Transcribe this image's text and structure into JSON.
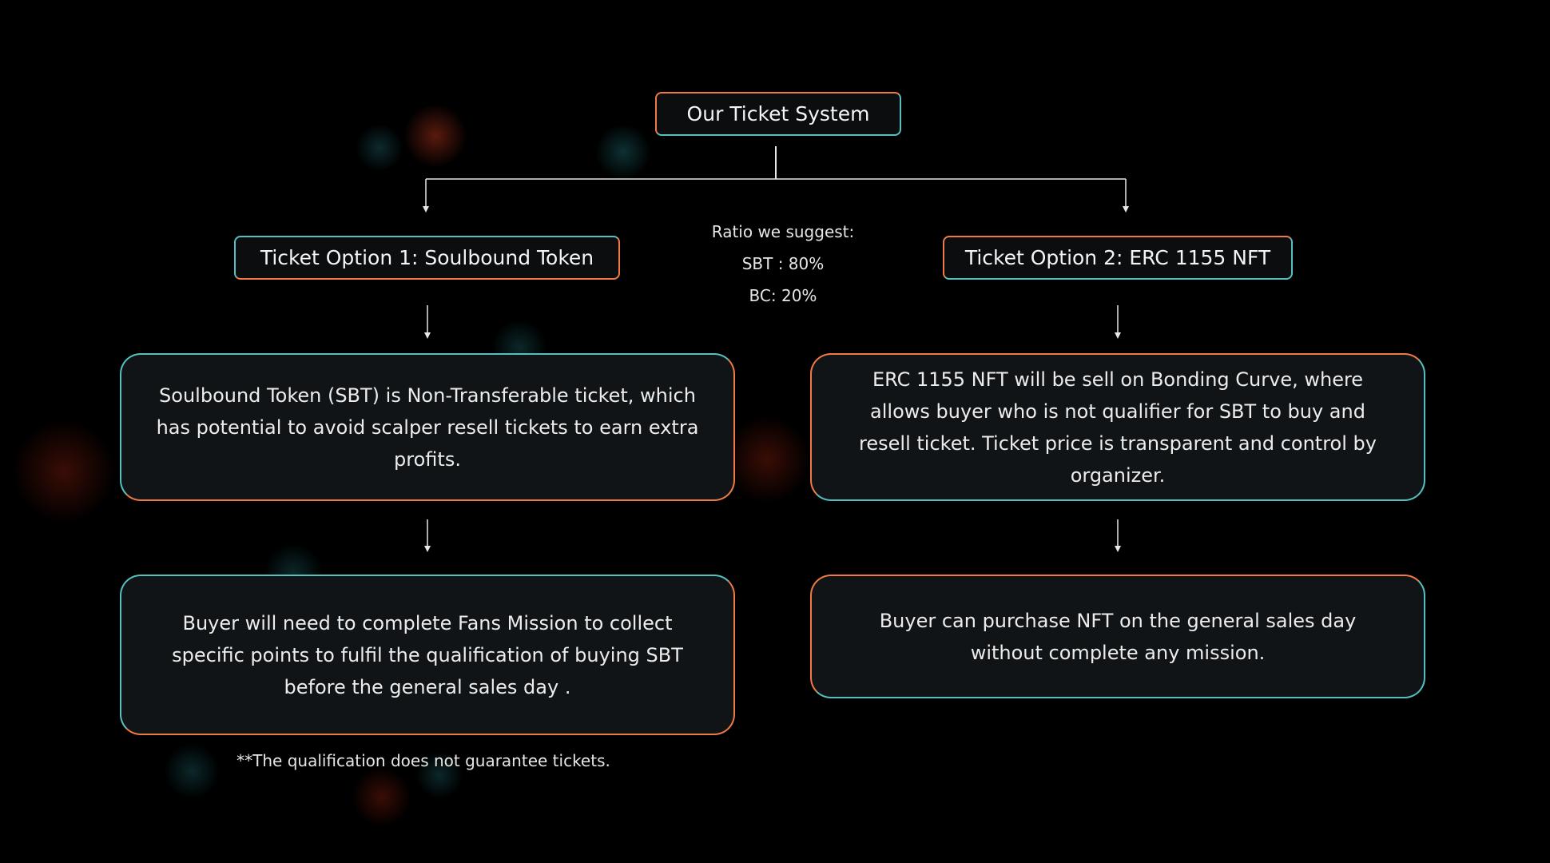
{
  "root": {
    "label": "Our Ticket System"
  },
  "options": [
    {
      "title": "Ticket Option 1: Soulbound Token",
      "description": "Soulbound Token (SBT) is Non-Transferable ticket, which has potential to avoid scalper resell tickets to earn extra profits.",
      "requirement": "Buyer will need to complete Fans Mission to collect specific points to fulfil the qualification of buying SBT before the general sales day ."
    },
    {
      "title": "Ticket Option 2: ERC 1155 NFT",
      "description": "ERC 1155 NFT will be sell on Bonding Curve, where allows buyer who is not qualifier for SBT to buy and resell ticket. Ticket price is transparent and control by organizer.",
      "requirement": "Buyer can purchase NFT on the general sales day without complete any mission."
    }
  ],
  "ratio": {
    "heading": "Ratio we suggest:",
    "line1": "SBT : 80%",
    "line2": "BC: 20%"
  },
  "footnote": "**The qualification does not guarantee tickets.",
  "colors": {
    "background": "#000000",
    "accent_orange": "#f07a44",
    "accent_teal": "#56c0c0",
    "card_fill": "#111416",
    "text": "#f2f2f2"
  }
}
